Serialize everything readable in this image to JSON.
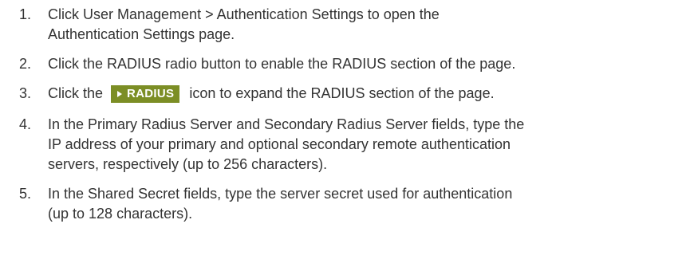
{
  "steps": [
    {
      "number": "1.",
      "lines": [
        "Click User Management > Authentication Settings to open the",
        "Authentication Settings page."
      ]
    },
    {
      "number": "2.",
      "lines": [
        "Click the RADIUS radio button to enable the RADIUS section of the page."
      ]
    },
    {
      "number": "3.",
      "before_icon": "Click the",
      "icon_label": "RADIUS",
      "icon": "radius-expand-icon",
      "after_icon": "icon to expand the RADIUS section of the page."
    },
    {
      "number": "4.",
      "lines": [
        "In the Primary Radius Server and Secondary Radius Server fields, type the",
        "IP address of your primary and optional secondary remote authentication",
        "servers, respectively (up to 256 characters)."
      ]
    },
    {
      "number": "5.",
      "lines": [
        "In the Shared Secret fields, type the server secret used for authentication",
        "(up to 128 characters)."
      ]
    }
  ],
  "colors": {
    "text": "#333333",
    "badge_bg": "#7c8e25",
    "badge_text": "#ffffff"
  }
}
